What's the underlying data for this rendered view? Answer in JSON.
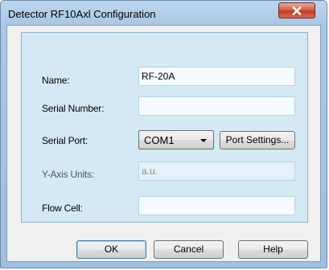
{
  "window": {
    "title": "Detector RF10Axl Configuration",
    "close_icon": "close-icon"
  },
  "form": {
    "name_label": "Name:",
    "name_value": "RF-20A",
    "serial_number_label": "Serial Number:",
    "serial_number_value": "",
    "serial_port_label": "Serial Port:",
    "serial_port_value": "COM1",
    "port_settings_label": "Port Settings...",
    "y_axis_units_label": "Y-Axis Units:",
    "y_axis_units_value": "a.u.",
    "flow_cell_label": "Flow Cell:",
    "flow_cell_value": ""
  },
  "buttons": {
    "ok": "OK",
    "cancel": "Cancel",
    "help": "Help"
  },
  "colors": {
    "close_button": "#c23a22",
    "group_background": "#d4e9f4",
    "frame": "#a9c8e6"
  }
}
